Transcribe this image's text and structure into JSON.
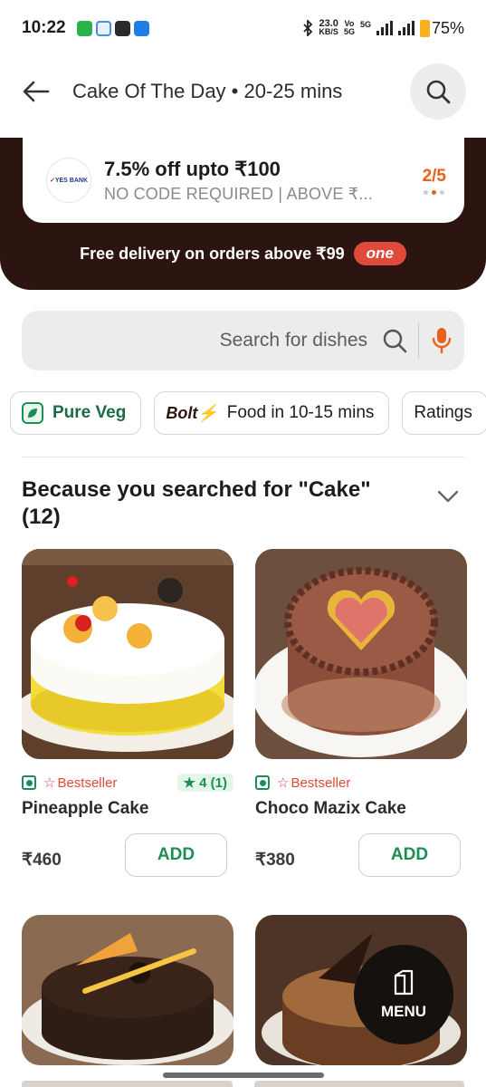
{
  "status_bar": {
    "time": "10:22",
    "net_speed_value": "23.0",
    "net_speed_unit": "KB/S",
    "volte_top": "Vo",
    "volte_bottom": "5G",
    "network": "5G",
    "battery": "75%"
  },
  "header": {
    "title": "Cake Of The Day • 20-25 mins"
  },
  "offer": {
    "bank_name": "YES BANK",
    "title": "7.5% off upto ₹100",
    "subtitle": "NO CODE REQUIRED  |  ABOVE ₹...",
    "page": "2/5",
    "free_delivery": "Free delivery on orders above ₹99",
    "badge": "one"
  },
  "search": {
    "placeholder": "Search for dishes"
  },
  "filters": {
    "pure_veg": "Pure Veg",
    "bolt_brand": "Bolt",
    "bolt_label": "Food in 10-15 mins",
    "ratings": "Ratings"
  },
  "section": {
    "title_line1": "Because you searched for \"Cake\"",
    "title_line2": "(12)"
  },
  "items": [
    {
      "name": "Pineapple Cake",
      "badge": "Bestseller",
      "rating": "4 (1)",
      "price": "₹460",
      "add_label": "ADD"
    },
    {
      "name": "Choco Mazix Cake",
      "badge": "Bestseller",
      "price": "₹380",
      "add_label": "ADD"
    }
  ],
  "menu_button": {
    "label": "MENU"
  },
  "colors": {
    "brand_orange": "#e8621a",
    "veg_green": "#1d8d57",
    "dark_band": "#2c1410",
    "bestseller_red": "#e04a3a"
  }
}
